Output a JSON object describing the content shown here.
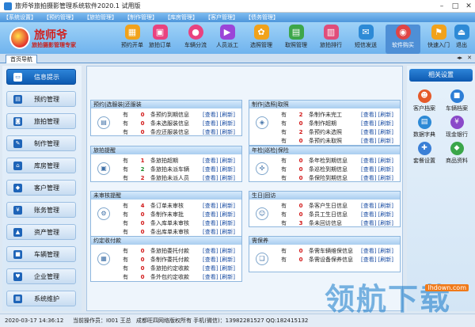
{
  "window": {
    "title": "旅师爷旅拍摄影管理系统软件2020.1 试用版"
  },
  "menu": [
    "【系统设置】",
    "【预约管理】",
    "【旅拍管理】",
    "【制作管理】",
    "【库房管理】",
    "【客户管理】",
    "【债务管理】"
  ],
  "logo": {
    "name": "旅师爷",
    "slogan": "旅拍摄影管理专家"
  },
  "toolbar": [
    {
      "label": "预约开单",
      "icon": "calendar-icon",
      "color": "#f1a21b"
    },
    {
      "label": "旅拍订单",
      "icon": "bag-icon",
      "color": "#e9427f"
    },
    {
      "label": "车辆分流",
      "icon": "car-icon",
      "color": "#e9427f"
    },
    {
      "label": "人员派工",
      "icon": "play-icon",
      "color": "#9b45d8"
    },
    {
      "label": "选照管理",
      "icon": "gear-icon",
      "color": "#f1a21b"
    },
    {
      "label": "取照管理",
      "icon": "box-icon",
      "color": "#3da64a"
    },
    {
      "label": "旅拍排行",
      "icon": "bar-chart-icon",
      "color": "#e04d7a"
    },
    {
      "label": "短信发送",
      "icon": "mail-icon",
      "color": "#2d8ad6"
    },
    {
      "label": "软件购买",
      "icon": "location-icon",
      "color": "#e04545"
    },
    {
      "label": "快速入门",
      "icon": "flag-icon",
      "color": "#f1a21b"
    },
    {
      "label": "退出",
      "icon": "exit-icon",
      "color": "#2d8ad6"
    }
  ],
  "tabs": {
    "home": "首页导航"
  },
  "sidebar": [
    {
      "label": "信息提示",
      "icon": "monitor-icon"
    },
    {
      "label": "预约管理",
      "icon": "clipboard-icon"
    },
    {
      "label": "旅拍管理",
      "icon": "camera-icon"
    },
    {
      "label": "制作管理",
      "icon": "edit-icon"
    },
    {
      "label": "库房管理",
      "icon": "home-icon"
    },
    {
      "label": "客户管理",
      "icon": "tag-icon"
    },
    {
      "label": "账务管理",
      "icon": "money-icon"
    },
    {
      "label": "资产管理",
      "icon": "asset-icon"
    },
    {
      "label": "车辆管理",
      "icon": "car-icon"
    },
    {
      "label": "企业管理",
      "icon": "heart-icon"
    },
    {
      "label": "系统维护",
      "icon": "grid-icon"
    }
  ],
  "panels": [
    {
      "title": "预约|选服装|还服装",
      "icon": "clipboard-icon",
      "rows": [
        {
          "have": "有",
          "n": "0",
          "desc": "条预约到期信息",
          "color": "#d21a1a"
        },
        {
          "have": "有",
          "n": "0",
          "desc": "条未选服装信息",
          "color": "#d21a1a"
        },
        {
          "have": "有",
          "n": "0",
          "desc": "条应还服装信息",
          "color": "#d21a1a"
        }
      ]
    },
    {
      "title": "制作|选照|取照",
      "icon": "stack-icon",
      "rows": [
        {
          "have": "有",
          "n": "2",
          "desc": "条制作未完工",
          "color": "#d21a1a"
        },
        {
          "have": "有",
          "n": "0",
          "desc": "条制作超期",
          "color": "#d21a1a"
        },
        {
          "have": "有",
          "n": "2",
          "desc": "条预约未选照",
          "color": "#d21a1a"
        },
        {
          "have": "有",
          "n": "0",
          "desc": "条预约未取照",
          "color": "#d21a1a"
        }
      ]
    },
    {
      "title": "旅拍提醒",
      "icon": "bag-icon",
      "rows": [
        {
          "have": "有",
          "n": "1",
          "desc": "条旅拍超期",
          "color": "#d21a1a"
        },
        {
          "have": "有",
          "n": "2",
          "desc": "条旅拍未派车辆",
          "color": "#1b8b2b"
        },
        {
          "have": "有",
          "n": "2",
          "desc": "条旅拍未派人员",
          "color": "#d21a1a"
        }
      ]
    },
    {
      "title": "年检|巡检|保险",
      "icon": "network-icon",
      "rows": [
        {
          "have": "有",
          "n": "0",
          "desc": "条年检到期信息",
          "color": "#d21a1a"
        },
        {
          "have": "有",
          "n": "0",
          "desc": "条巡检到期信息",
          "color": "#d21a1a"
        },
        {
          "have": "有",
          "n": "0",
          "desc": "条保险到期信息",
          "color": "#d21a1a"
        }
      ]
    },
    {
      "title": "未审核提醒",
      "icon": "settings-icon",
      "rows": [
        {
          "have": "有",
          "n": "4",
          "desc": "条订单未审核",
          "color": "#d21a1a"
        },
        {
          "have": "有",
          "n": "0",
          "desc": "条制作未审批",
          "color": "#d21a1a"
        },
        {
          "have": "有",
          "n": "0",
          "desc": "条入库单未审核",
          "color": "#d21a1a"
        },
        {
          "have": "有",
          "n": "0",
          "desc": "条出库单未审核",
          "color": "#d21a1a"
        }
      ]
    },
    {
      "title": "生日|回访",
      "icon": "people-icon",
      "rows": [
        {
          "have": "有",
          "n": "0",
          "desc": "条客户生日信息",
          "color": "#d21a1a"
        },
        {
          "have": "有",
          "n": "0",
          "desc": "条员工生日信息",
          "color": "#d21a1a"
        },
        {
          "have": "有",
          "n": "3",
          "desc": "条未回访信息",
          "color": "#d21a1a"
        }
      ]
    },
    {
      "title": "约定收付款",
      "icon": "cart-icon",
      "rows": [
        {
          "have": "有",
          "n": "0",
          "desc": "条旅拍委托付款",
          "color": "#d21a1a"
        },
        {
          "have": "有",
          "n": "0",
          "desc": "条制作委托付款",
          "color": "#d21a1a"
        },
        {
          "have": "有",
          "n": "0",
          "desc": "条旅拍约定收款",
          "color": "#d21a1a"
        },
        {
          "have": "有",
          "n": "0",
          "desc": "条外包约定收款",
          "color": "#d21a1a"
        }
      ]
    },
    {
      "title": "需保养",
      "icon": "bookmark-icon",
      "rows": [
        {
          "have": "有",
          "n": "0",
          "desc": "条需车辆维保信息",
          "color": "#d21a1a"
        },
        {
          "have": "有",
          "n": "0",
          "desc": "条需设备保养信息",
          "color": "#d21a1a"
        }
      ]
    }
  ],
  "links": {
    "view": "[查看]",
    "refresh": "[刷新]"
  },
  "right": {
    "header": "相关设置",
    "items": [
      {
        "label": "客户档案",
        "icon": "user-icon",
        "color": "#e55a2a"
      },
      {
        "label": "车辆档案",
        "icon": "car-icon",
        "color": "#2d7ed6"
      },
      {
        "label": "数据字典",
        "icon": "book-icon",
        "color": "#2d8ad6"
      },
      {
        "label": "现金银行",
        "icon": "bank-icon",
        "color": "#8a49c9"
      },
      {
        "label": "套餐设置",
        "icon": "package-icon",
        "color": "#3a7fd6"
      },
      {
        "label": "商品资料",
        "icon": "product-icon",
        "color": "#3aa64a"
      }
    ]
  },
  "status": {
    "datetime": "2020-03-17 14:36:12",
    "operator": "当前操作员：I001 王总",
    "company": "成都旺四网络版权所有  手机(微信)：13982281527  QQ:182415132"
  },
  "watermark": {
    "cn": "领航下载",
    "en": "lhdown.com"
  }
}
